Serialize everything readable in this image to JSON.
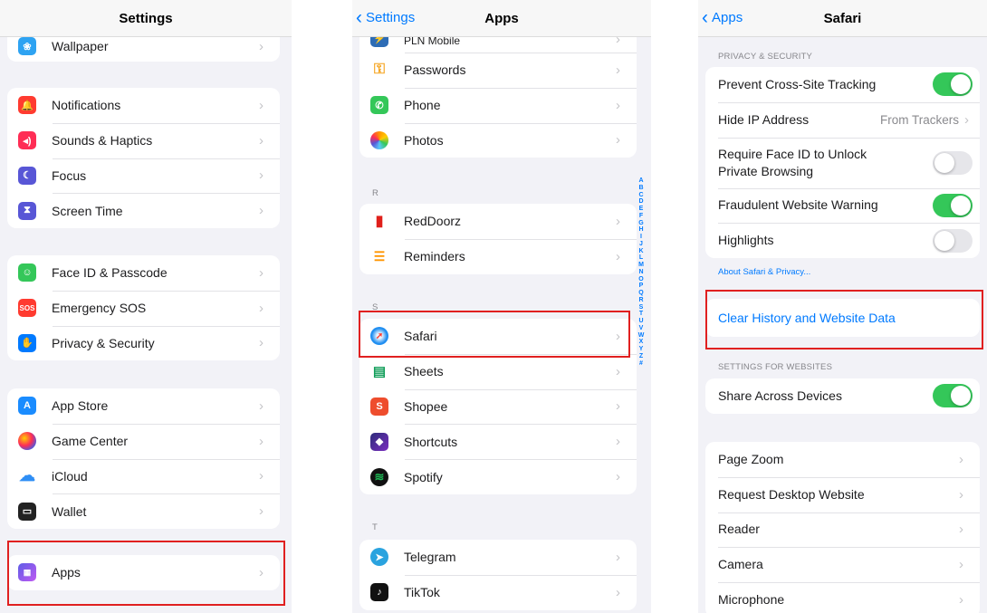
{
  "settings_screen": {
    "title": "Settings",
    "partial_item": "Wallpaper",
    "group1": [
      "Notifications",
      "Sounds & Haptics",
      "Focus",
      "Screen Time"
    ],
    "group2": [
      "Face ID & Passcode",
      "Emergency SOS",
      "Privacy & Security"
    ],
    "group3": [
      "App Store",
      "Game Center",
      "iCloud",
      "Wallet"
    ],
    "apps_item": "Apps",
    "sos_badge": "SOS"
  },
  "apps_screen": {
    "back_label": "Settings",
    "title": "Apps",
    "partial_item": "PLN Mobile",
    "group_p": [
      "Passwords",
      "Phone",
      "Photos"
    ],
    "section_r": "R",
    "group_r": [
      "RedDoorz",
      "Reminders"
    ],
    "section_s": "S",
    "group_s": [
      "Safari",
      "Sheets",
      "Shopee",
      "Shortcuts",
      "Spotify"
    ],
    "section_t": "T",
    "group_t": [
      "Telegram",
      "TikTok"
    ],
    "index_letters": [
      "A",
      "B",
      "C",
      "D",
      "E",
      "F",
      "G",
      "H",
      "I",
      "J",
      "K",
      "L",
      "M",
      "N",
      "O",
      "P",
      "Q",
      "R",
      "S",
      "T",
      "U",
      "V",
      "W",
      "X",
      "Y",
      "Z",
      "#"
    ]
  },
  "safari_screen": {
    "back_label": "Apps",
    "title": "Safari",
    "privacy_header": "PRIVACY & SECURITY",
    "prevent_tracking": "Prevent Cross-Site Tracking",
    "hide_ip": "Hide IP Address",
    "hide_ip_value": "From Trackers",
    "face_id_line1": "Require Face ID to Unlock",
    "face_id_line2": "Private Browsing",
    "fraud_warning": "Fraudulent Website Warning",
    "highlights": "Highlights",
    "about_link": "About Safari & Privacy...",
    "clear_history": "Clear History and Website Data",
    "websites_header": "SETTINGS FOR WEBSITES",
    "share_devices": "Share Across Devices",
    "website_settings": [
      "Page Zoom",
      "Request Desktop Website",
      "Reader",
      "Camera",
      "Microphone"
    ]
  },
  "colors": {
    "accent": "#007aff",
    "toggle_on": "#34c759",
    "highlight_box": "#e02020"
  }
}
